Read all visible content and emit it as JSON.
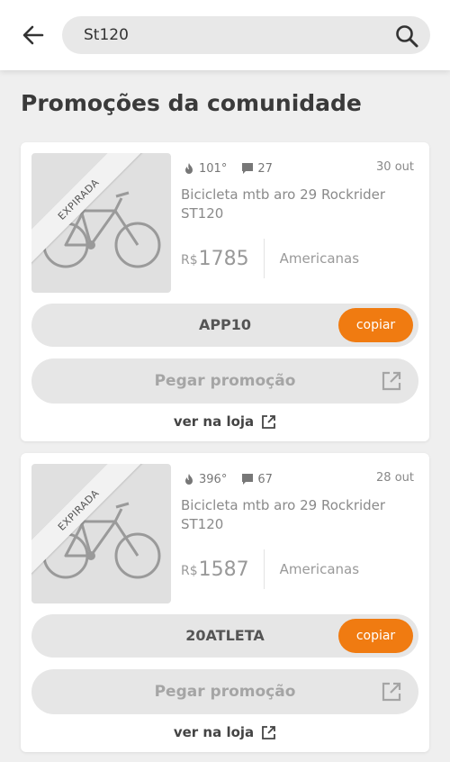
{
  "header": {
    "back_icon": "arrow-left-icon",
    "search_value": "St120",
    "search_icon": "search-icon"
  },
  "page_title": "Promoções da comunidade",
  "promotions": [
    {
      "badge": "EXPIRADA",
      "temperature": "101°",
      "comments": "27",
      "date": "30 out",
      "title": "Bicicleta mtb aro 29 Rockrider ST120",
      "currency": "R$",
      "price": "1785",
      "store": "Americanas",
      "coupon_code": "APP10",
      "copy_label": "copiar",
      "get_label": "Pegar promoção",
      "store_link": "ver na loja"
    },
    {
      "badge": "EXPIRADA",
      "temperature": "396°",
      "comments": "67",
      "date": "28 out",
      "title": "Bicicleta mtb aro 29 Rockrider ST120",
      "currency": "R$",
      "price": "1587",
      "store": "Americanas",
      "coupon_code": "20ATLETA",
      "copy_label": "copiar",
      "get_label": "Pegar promoção",
      "store_link": "ver na loja"
    }
  ],
  "colors": {
    "accent": "#f07b11",
    "background": "#efefef",
    "card": "#ffffff"
  }
}
